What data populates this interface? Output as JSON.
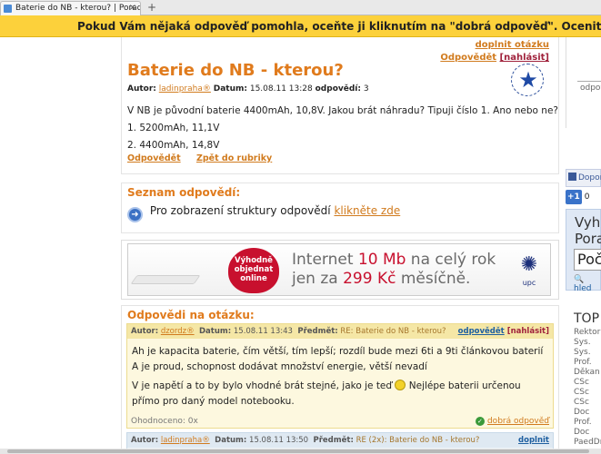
{
  "browser": {
    "tab_title": "Baterie do NB - kterou? | Poradte.cz",
    "tab_close": "×",
    "new_tab": "+"
  },
  "banner": {
    "text": "Pokud Vám nějaká odpověď pomohla, oceňte ji kliknutím na \"dobrá odpověď\". Ocenit můžete maxima"
  },
  "question": {
    "link_answer": "doplnit otázku",
    "link_reply": "Odpovědět",
    "link_report": "[nahlásit]",
    "title": "Baterie do NB - kterou?",
    "author_label": "Autor:",
    "author": "ladinpraha®",
    "date_label": "Datum:",
    "date": "15.08.11 13:28",
    "answers_label": "odpovědí:",
    "answers_count": "3",
    "badge_text": "k oblíbeným",
    "body": [
      "V NB je původní baterie 4400mAh, 10,8V. Jakou brát náhradu? Tipuji číslo 1. Ano nebo ne?",
      "1. 5200mAh, 11,1V",
      "2. 4400mAh, 14,8V"
    ],
    "action_reply": "Odpovědět",
    "action_back": "Zpět do rubriky"
  },
  "answer_list": {
    "heading": "Seznam odpovědí:",
    "text": "Pro zobrazení struktury odpovědí",
    "link": "klikněte zde"
  },
  "ad": {
    "heart_text": "Výhodně objednat online",
    "line1_pre": "Internet ",
    "line1_hl": "10 Mb",
    "line1_post": " na celý rok",
    "line2_pre": "jen za ",
    "line2_hl": "299 Kč",
    "line2_post": " měsíčně.",
    "logo": "upc"
  },
  "answers": {
    "heading": "Odpovědi na otázku:",
    "items": [
      {
        "author_label": "Autor:",
        "author": "dzordz®",
        "date_label": "Datum:",
        "date": "15.08.11 13:43",
        "subject_label": "Předmět:",
        "subject": "RE: Baterie do NB - kterou?",
        "reply": "odpovědět",
        "report": "[nahlásit]",
        "p1": "Ah je kapacita baterie, čím větší, tím lepší; rozdíl bude mezi 6ti a 9ti článkovou baterií",
        "p2": "A je proud, schopnost dodávat množství energie, větší nevadí",
        "p3a": "V je napětí a to by bylo vhodné brát stejné, jako je teď",
        "p3b": "Nejlépe baterii určenou přímo pro daný model notebooku.",
        "rating": "Ohodnoceno: 0x",
        "good": "dobrá odpověď"
      },
      {
        "author_label": "Autor:",
        "author": "ladinpraha®",
        "date_label": "Datum:",
        "date": "15.08.11 13:50",
        "subject_label": "Předmět:",
        "subject": "RE (2x): Baterie do NB - kterou?",
        "reply": "doplnit",
        "report": ""
      }
    ]
  },
  "sidebar": {
    "odpov": "odpov",
    "fb": "Dopor",
    "gplus": "+1",
    "gcount": "0",
    "search_title": "Vyhl Pora",
    "search_value": "Poč",
    "search_link": "hled",
    "top_title": "TOP",
    "top_items": [
      "Rektor",
      "Sys.",
      "Sys.",
      "Prof.",
      "Děkan",
      "CSc",
      "CSc",
      "CSc",
      "Doc",
      "Prof.",
      "Doc",
      "PaedDr"
    ]
  }
}
